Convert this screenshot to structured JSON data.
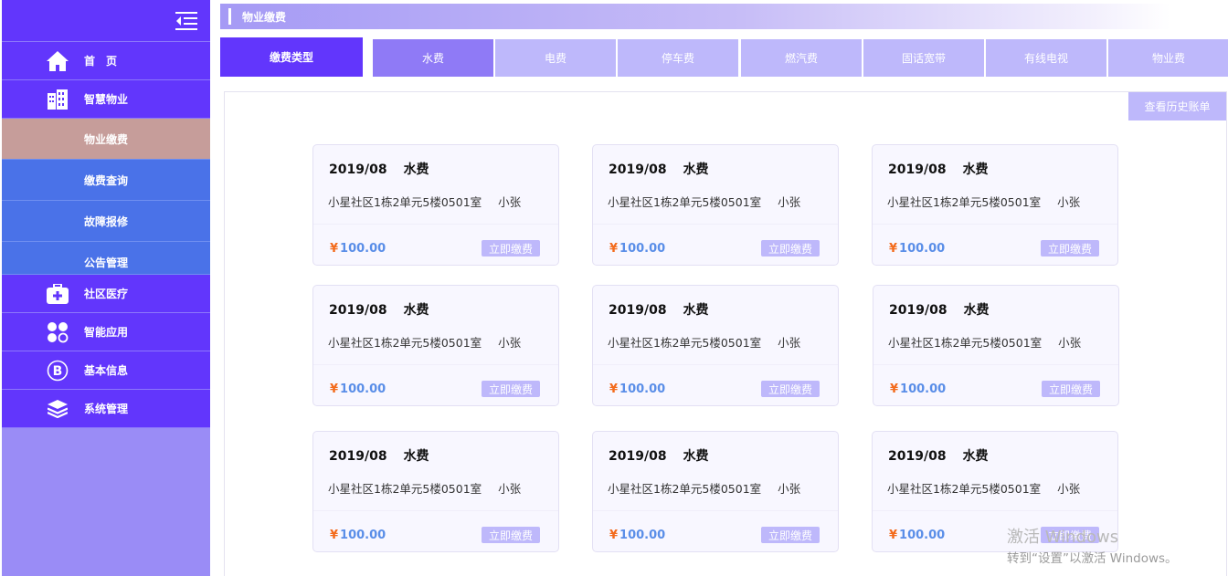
{
  "sidebar": {
    "items": [
      {
        "label": "首　页",
        "icon": "home-icon"
      },
      {
        "label": "智慧物业",
        "icon": "building-icon"
      },
      {
        "label": "物业缴费"
      },
      {
        "label": "缴费查询"
      },
      {
        "label": "故障报修"
      },
      {
        "label": "公告管理"
      },
      {
        "label": "社区医疗",
        "icon": "medical-kit-icon"
      },
      {
        "label": "智能应用",
        "icon": "clover-icon"
      },
      {
        "label": "基本信息",
        "icon": "bitcoin-icon"
      },
      {
        "label": "系统管理",
        "icon": "layers-icon"
      }
    ]
  },
  "header": {
    "title": "物业缴费"
  },
  "tabs": {
    "type_label": "缴费类型",
    "items": [
      "水费",
      "电费",
      "停车费",
      "燃汽费",
      "固话宽带",
      "有线电视",
      "物业费"
    ]
  },
  "history_button": "查看历史账单",
  "bills": [
    {
      "period": "2019/08",
      "type": "水费",
      "address": "小星社区1栋2单元5楼0501室",
      "person": "小张",
      "currency": "¥",
      "amount": "100.00",
      "action": "立即缴费"
    },
    {
      "period": "2019/08",
      "type": "水费",
      "address": "小星社区1栋2单元5楼0501室",
      "person": "小张",
      "currency": "¥",
      "amount": "100.00",
      "action": "立即缴费"
    },
    {
      "period": "2019/08",
      "type": "水费",
      "address": "小星社区1栋2单元5楼0501室",
      "person": "小张",
      "currency": "¥",
      "amount": "100.00",
      "action": "立即缴费"
    },
    {
      "period": "2019/08",
      "type": "水费",
      "address": "小星社区1栋2单元5楼0501室",
      "person": "小张",
      "currency": "¥",
      "amount": "100.00",
      "action": "立即缴费"
    },
    {
      "period": "2019/08",
      "type": "水费",
      "address": "小星社区1栋2单元5楼0501室",
      "person": "小张",
      "currency": "¥",
      "amount": "100.00",
      "action": "立即缴费"
    },
    {
      "period": "2019/08",
      "type": "水费",
      "address": "小星社区1栋2单元5楼0501室",
      "person": "小张",
      "currency": "¥",
      "amount": "100.00",
      "action": "立即缴费"
    },
    {
      "period": "2019/08",
      "type": "水费",
      "address": "小星社区1栋2单元5楼0501室",
      "person": "小张",
      "currency": "¥",
      "amount": "100.00",
      "action": "立即缴费"
    },
    {
      "period": "2019/08",
      "type": "水费",
      "address": "小星社区1栋2单元5楼0501室",
      "person": "小张",
      "currency": "¥",
      "amount": "100.00",
      "action": "立即缴费"
    },
    {
      "period": "2019/08",
      "type": "水费",
      "address": "小星社区1栋2单元5楼0501室",
      "person": "小张",
      "currency": "¥",
      "amount": "100.00",
      "action": "立即缴费"
    }
  ],
  "watermark": {
    "line1": "激活 Windows",
    "line2": "转到“设置”以激活 Windows。"
  },
  "colors": {
    "primary": "#6236fc",
    "submenu": "#4a72e8",
    "submenu_active": "#c69d9a",
    "accent_light": "#beb8fb",
    "tab_active": "#8f7af6",
    "amount": "#5a8ee8",
    "currency": "#f36b1c"
  }
}
